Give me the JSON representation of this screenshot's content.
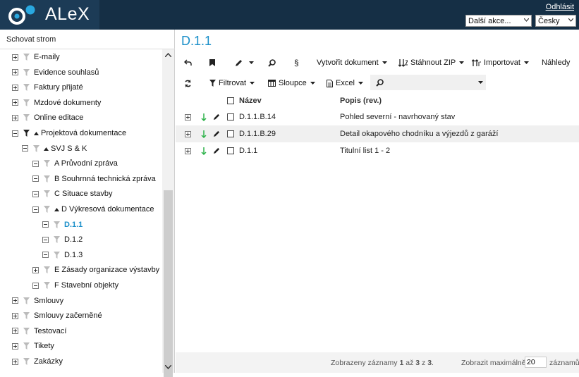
{
  "header": {
    "logo_text": "ALeX",
    "logout": "Odhlásit",
    "actions_select": "Další akce...",
    "language_select": "Česky",
    "accent": "#1a8fc9",
    "bg": "#152f45"
  },
  "sidebar": {
    "hide_tree": "Schovat strom",
    "items": [
      {
        "label": "E-maily",
        "level": 0,
        "toggle": "plus"
      },
      {
        "label": "Evidence souhlasů",
        "level": 0,
        "toggle": "plus"
      },
      {
        "label": "Faktury přijaté",
        "level": 0,
        "toggle": "plus"
      },
      {
        "label": "Mzdové dokumenty",
        "level": 0,
        "toggle": "plus"
      },
      {
        "label": "Online editace",
        "level": 0,
        "toggle": "plus"
      },
      {
        "label": "Projektová dokumentace",
        "level": 0,
        "toggle": "minus",
        "expanded": true
      },
      {
        "label": "SVJ S & K",
        "level": 1,
        "toggle": "minus",
        "expanded": true
      },
      {
        "label": "A Průvodní zpráva",
        "level": 2,
        "toggle": "minus"
      },
      {
        "label": "B Souhrnná technická zpráva",
        "level": 2,
        "toggle": "minus"
      },
      {
        "label": "C Situace stavby",
        "level": 2,
        "toggle": "minus"
      },
      {
        "label": "D Výkresová dokumentace",
        "level": 2,
        "toggle": "minus",
        "expanded": true
      },
      {
        "label": "D.1.1",
        "level": 3,
        "toggle": "minus",
        "active": true
      },
      {
        "label": "D.1.2",
        "level": 3,
        "toggle": "minus"
      },
      {
        "label": "D.1.3",
        "level": 3,
        "toggle": "minus"
      },
      {
        "label": "E Zásady organizace výstavby",
        "level": 2,
        "toggle": "plus"
      },
      {
        "label": "F Stavební objekty",
        "level": 2,
        "toggle": "minus"
      },
      {
        "label": "Smlouvy",
        "level": 0,
        "toggle": "plus"
      },
      {
        "label": "Smlouvy začerněné",
        "level": 0,
        "toggle": "plus"
      },
      {
        "label": "Testovací",
        "level": 0,
        "toggle": "plus"
      },
      {
        "label": "Tikety",
        "level": 0,
        "toggle": "plus"
      },
      {
        "label": "Zakázky",
        "level": 0,
        "toggle": "plus"
      }
    ]
  },
  "main": {
    "title": "D.1.1",
    "toolbar1": {
      "section": "§",
      "create_document": "Vytvořit dokument",
      "download_zip": "Stáhnout ZIP",
      "import": "Importovat",
      "previews": "Náhledy"
    },
    "toolbar2": {
      "filter": "Filtrovat",
      "columns": "Sloupce",
      "excel": "Excel",
      "search_value": ""
    },
    "table": {
      "col_name": "Název",
      "col_desc": "Popis (rev.)",
      "rows": [
        {
          "name": "D.1.1.B.14",
          "desc": "Pohled severní - navrhovaný stav"
        },
        {
          "name": "D.1.1.B.29",
          "desc": "Detail okapového chodníku a výjezdů z garáží"
        },
        {
          "name": "D.1.1",
          "desc": "Titulní list 1 - 2"
        }
      ]
    },
    "footer": {
      "count_prefix": "Zobrazeny záznamy ",
      "from": "1",
      "to_word": " až ",
      "to": "3",
      "of_word": " z ",
      "total": "3",
      "suffix": ".",
      "max_label": "Zobrazit maximálně",
      "max_value": "20",
      "unit": "záznamů."
    }
  }
}
